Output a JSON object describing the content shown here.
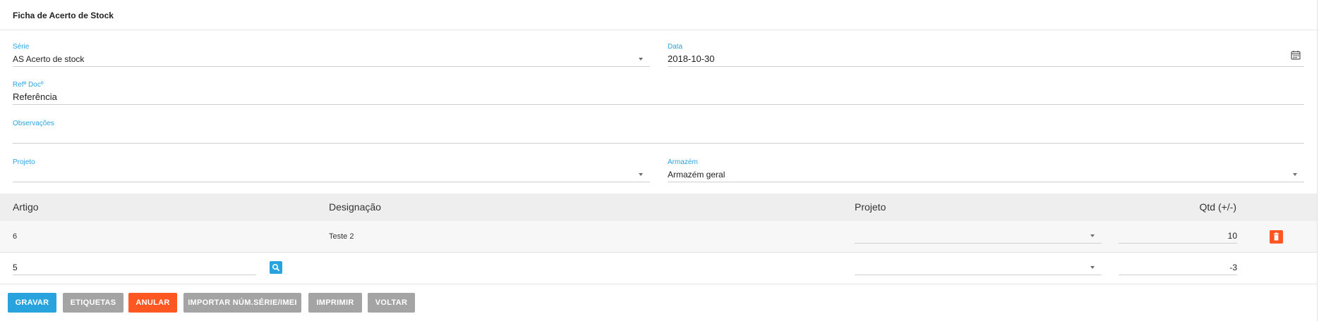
{
  "card": {
    "title": "Ficha de Acerto de Stock"
  },
  "form": {
    "serie": {
      "label": "Série",
      "value": "AS Acerto de stock"
    },
    "data": {
      "label": "Data",
      "value": "2018-10-30"
    },
    "ref_doc": {
      "label": "Refª Docº",
      "value": "Referência"
    },
    "observacoes": {
      "label": "Observações",
      "value": ""
    },
    "projeto": {
      "label": "Projeto",
      "value": ""
    },
    "armazem": {
      "label": "Armazém",
      "value": "Armazém geral"
    }
  },
  "table": {
    "headers": {
      "artigo": "Artigo",
      "designacao": "Designação",
      "projeto": "Projeto",
      "qtd": "Qtd (+/-)"
    },
    "rows": [
      {
        "artigo": "6",
        "designacao": "Teste 2",
        "projeto": "",
        "qtd": "10"
      }
    ],
    "new_row": {
      "artigo": "5",
      "projeto": "",
      "qtd": "-3"
    }
  },
  "actions": {
    "gravar": "GRAVAR",
    "etiquetas": "ETIQUETAS",
    "anular": "ANULAR",
    "importar": "IMPORTAR NÚM.SÉRIE/IMEI",
    "imprimir": "IMPRIMIR",
    "voltar": "VOLTAR"
  },
  "colors": {
    "accent": "#29a3dd",
    "danger": "#ff5722",
    "neutral_button": "#a4a4a4",
    "header_bg": "#eeeeee"
  },
  "icons": {
    "calendar": "calendar-icon",
    "dropdown": "chevron-down-icon",
    "search": "search-icon",
    "delete": "trash-icon"
  }
}
